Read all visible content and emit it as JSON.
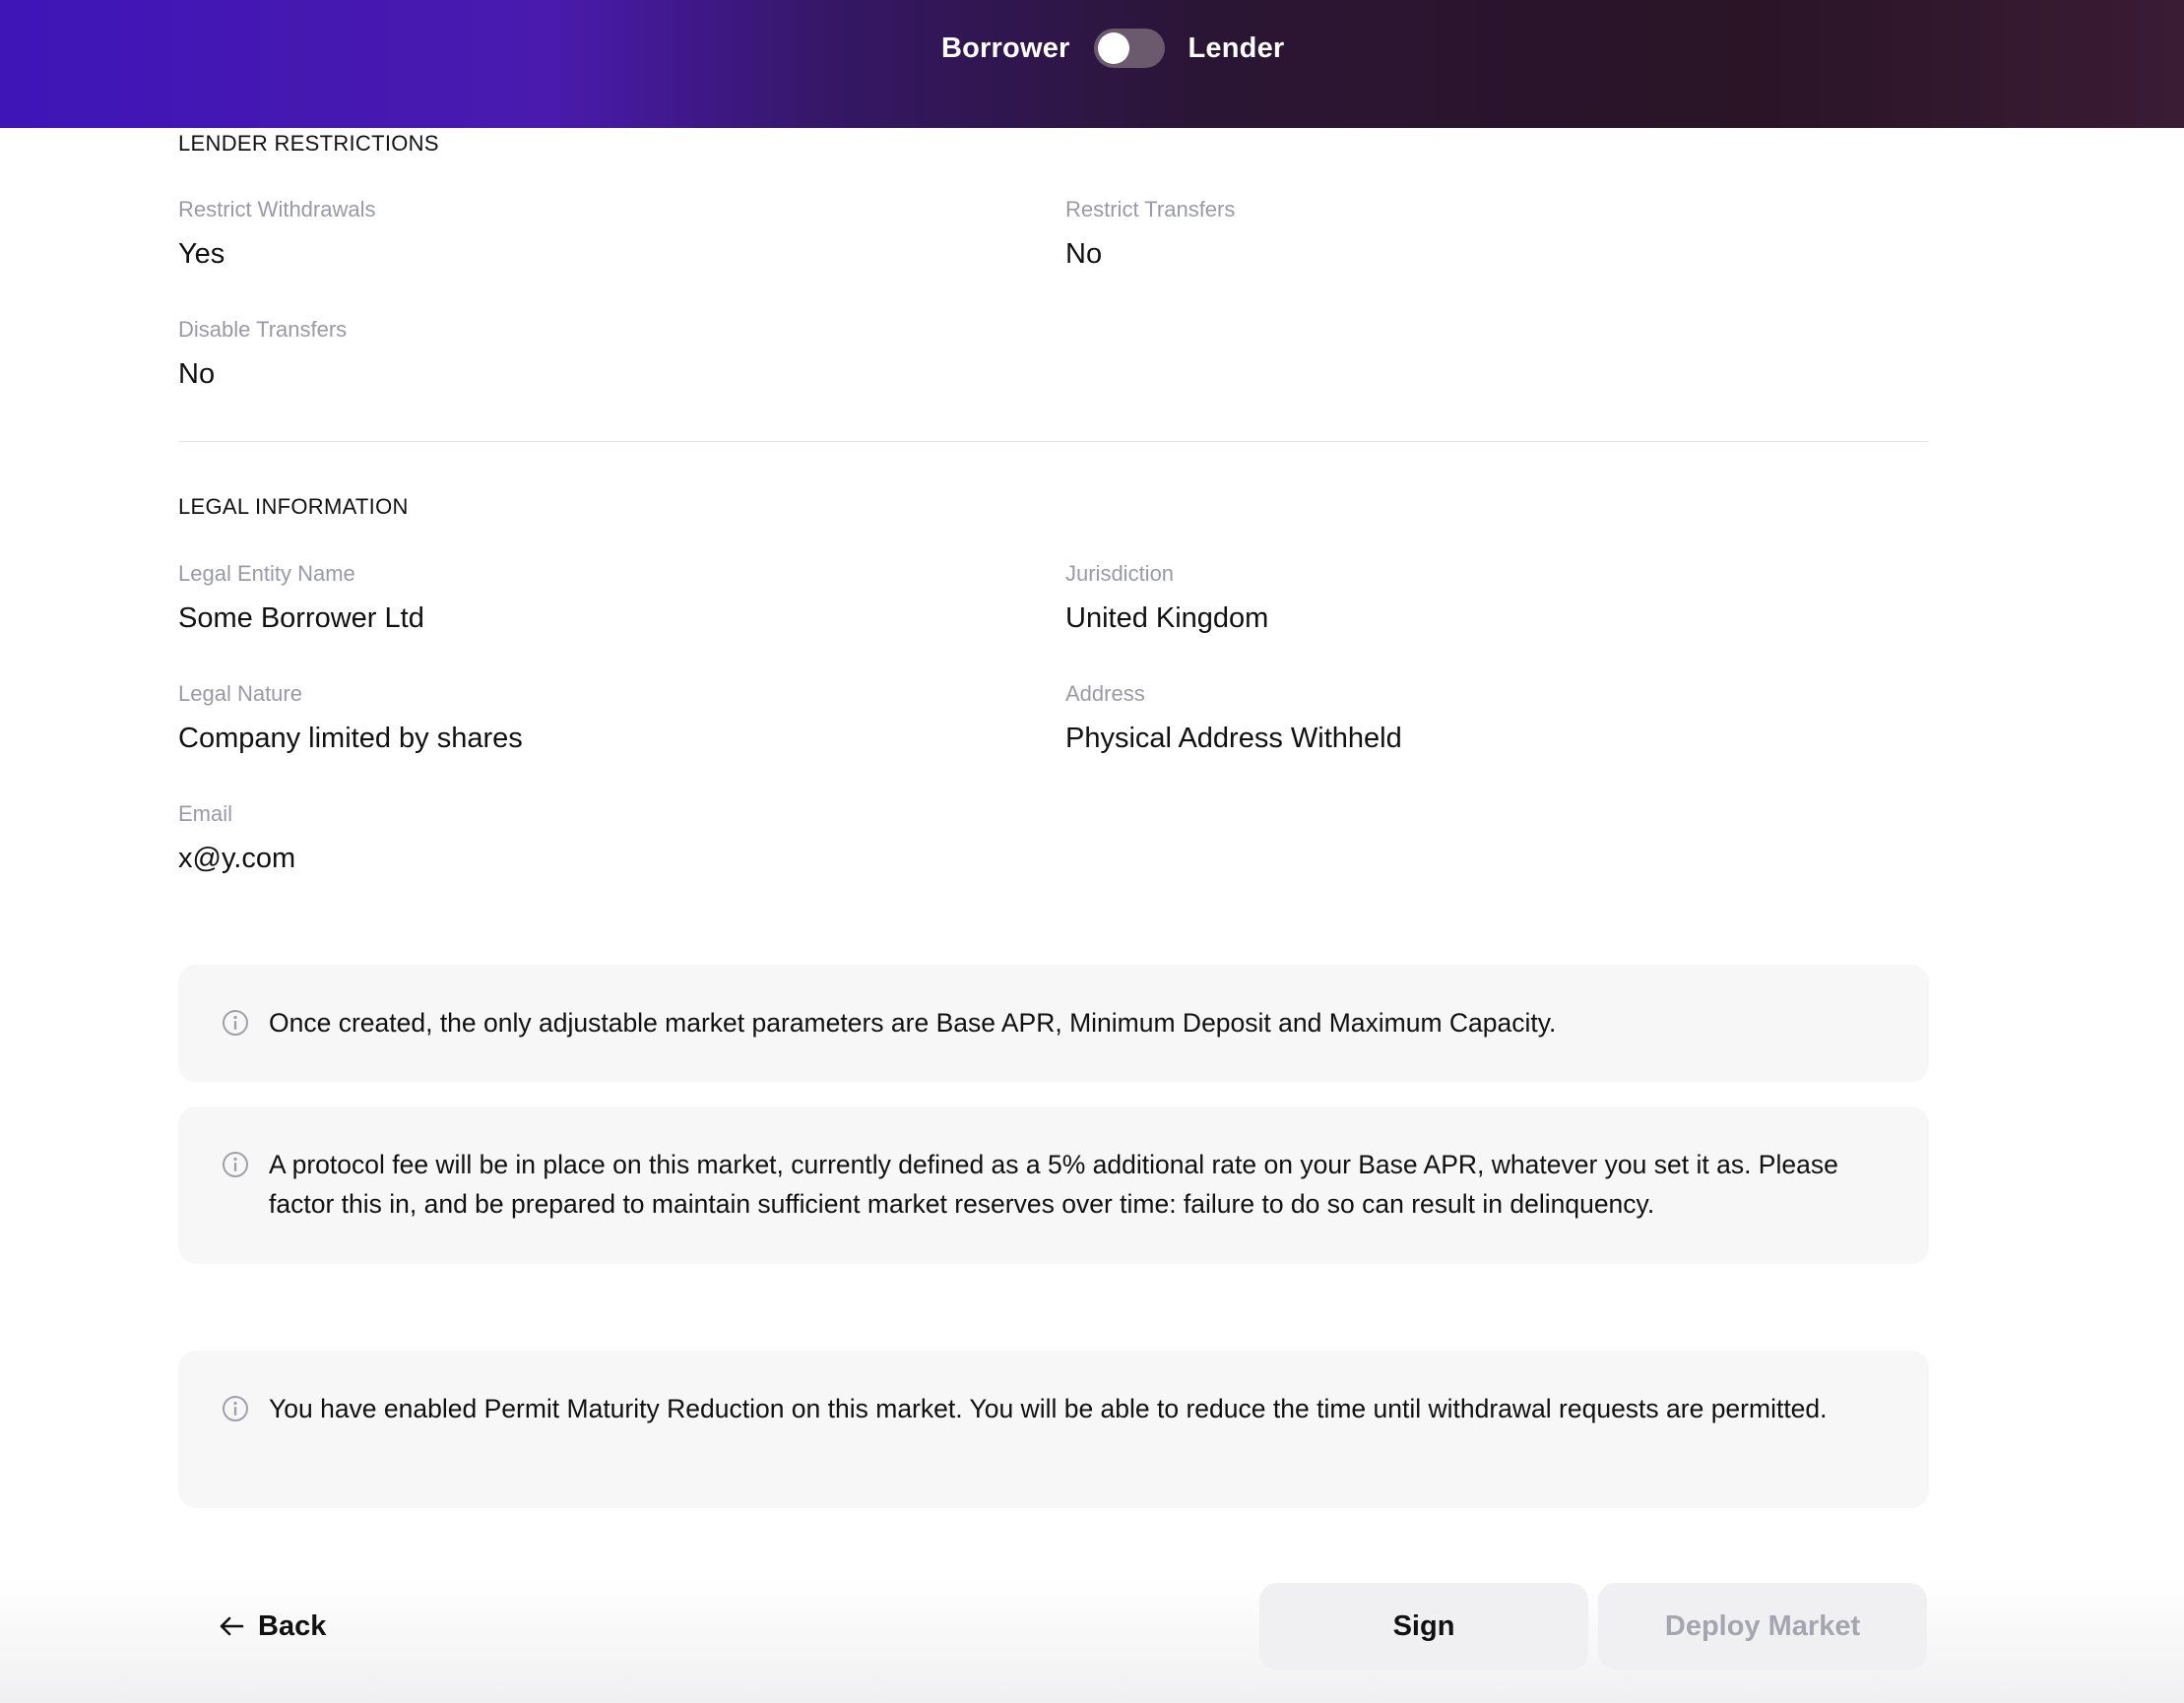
{
  "header": {
    "left_label": "Borrower",
    "right_label": "Lender",
    "toggle_state": "Borrower"
  },
  "lender_restrictions": {
    "title": "LENDER RESTRICTIONS",
    "fields": [
      {
        "label": "Restrict Withdrawals",
        "value": "Yes"
      },
      {
        "label": "Restrict Transfers",
        "value": "No"
      },
      {
        "label": "Disable Transfers",
        "value": "No"
      }
    ]
  },
  "legal_information": {
    "title": "LEGAL INFORMATION",
    "fields": [
      {
        "label": "Legal Entity Name",
        "value": "Some Borrower Ltd"
      },
      {
        "label": "Jurisdiction",
        "value": "United Kingdom"
      },
      {
        "label": "Legal Nature",
        "value": "Company limited by shares"
      },
      {
        "label": "Address",
        "value": "Physical Address Withheld"
      },
      {
        "label": "Email",
        "value": "x@y.com"
      }
    ]
  },
  "notes": [
    {
      "icon": "info-icon",
      "text": "Once created, the only adjustable market parameters are Base APR, Minimum Deposit and Maximum Capacity."
    },
    {
      "icon": "info-icon",
      "text": "A protocol fee will be in place on this market, currently defined as a 5% additional rate on your Base APR, whatever you set it as. Please factor this in, and be prepared to maintain sufficient market reserves over time: failure to do so can result in delinquency."
    },
    {
      "icon": "info-icon",
      "text": "You have enabled Permit Maturity Reduction on this market. You will be able to reduce the time until withdrawal requests are permitted."
    }
  ],
  "actions": {
    "back_label": "Back",
    "sign_label": "Sign",
    "deploy_label": "Deploy Market",
    "deploy_disabled": true
  },
  "colors": {
    "header_gradient_start": "#3f15b8",
    "header_gradient_end": "#2a1426",
    "label_gray": "#9a9aa6",
    "note_background": "#f7f7f8",
    "button_background": "#f0f0f3",
    "disabled_text": "#a5a5b0"
  }
}
